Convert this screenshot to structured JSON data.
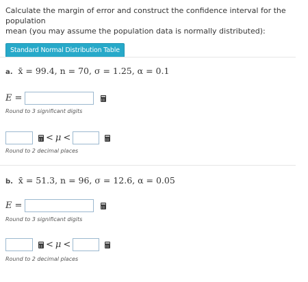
{
  "intro": {
    "line1": "Calculate the margin of error and construct the confidence interval for the population",
    "line2": "mean (you may assume the population data is normally distributed):"
  },
  "table_button": {
    "label": "Standard Normal Distribution Table"
  },
  "parts": [
    {
      "label": "a.",
      "math": "x̄ = 99.4, n = 70, σ = 1.25, α = 0.1",
      "e_label": "E",
      "e_sign": "=",
      "e_hint": "Round to 3 significant digits",
      "ineq_lt1": "<",
      "ineq_mu": "μ",
      "ineq_lt2": "<",
      "ci_hint": "Round to 2 decimal places"
    },
    {
      "label": "b.",
      "math": "x̄ = 51.3, n = 96, σ = 12.6, α = 0.05",
      "e_label": "E",
      "e_sign": "=",
      "e_hint": "Round to 3 significant digits",
      "ineq_lt1": "<",
      "ineq_mu": "μ",
      "ineq_lt2": "<",
      "ci_hint": "Round to 2 decimal places"
    }
  ]
}
